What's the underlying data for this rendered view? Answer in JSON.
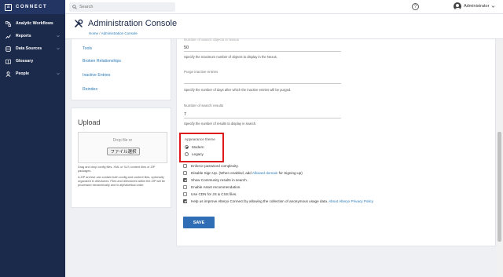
{
  "app": {
    "logo_letter": "a",
    "logo_text": "CONNECT"
  },
  "sidebar": {
    "items": [
      {
        "label": "Analytic Workflows",
        "icon": "workflow-icon",
        "has_chevron": false
      },
      {
        "label": "Reports",
        "icon": "chart-line-icon",
        "has_chevron": true
      },
      {
        "label": "Data Sources",
        "icon": "database-icon",
        "has_chevron": true
      },
      {
        "label": "Glossary",
        "icon": "book-icon",
        "has_chevron": false
      },
      {
        "label": "People",
        "icon": "person-icon",
        "has_chevron": true
      }
    ]
  },
  "topbar": {
    "search_placeholder": "Search",
    "help_label": "?",
    "user_name": "Administrator"
  },
  "header": {
    "title": "Administration Console",
    "breadcrumb_home": "Home",
    "breadcrumb_separator": "/",
    "breadcrumb_current": "Administration Console"
  },
  "left_nav": {
    "links": [
      "Tools",
      "Broken Relationships",
      "Inactive Entries",
      "Reindex"
    ]
  },
  "upload": {
    "title": "Upload",
    "drop_text": "Drop file or",
    "file_button": "ファイル選択",
    "note_1": "Drag and drop config files, XML or XLS content files or ZIP packages.",
    "note_2": "A ZIP archive can contain both config and content files, optionally organized in directories. Files and directories within the ZIP will be processed hierarchically and in alphabetical order."
  },
  "settings": {
    "field1_label": "Number of search objects in Nexus",
    "field1_value": "50",
    "field1_help": "Specify the maximum number of objects to display in the Nexus.",
    "field2_label": "Purge inactive entries",
    "field2_value": "",
    "field2_help": "Specify the number of days after which the inactive entries will be purged.",
    "field3_label": "Number of search results",
    "field3_value": "7",
    "field3_help": "Specify the number of results to display in search.",
    "appearance_title": "Appearance theme",
    "theme_modern": "Modern",
    "theme_legacy": "Legacy",
    "selected_theme": "Modern",
    "checkboxes": [
      {
        "label": "Enforce password complexity.",
        "checked": false
      },
      {
        "label": "Disable Sign Up. (When enabled, add ",
        "link": "Allowed domain",
        "suffix": " for Signing-up)",
        "checked": false
      },
      {
        "label": "Show Community results in search.",
        "checked": true
      },
      {
        "label": "Enable Asset recommendation.",
        "checked": false
      },
      {
        "label": "Use CDN for JS & CSS files.",
        "checked": false
      },
      {
        "label": "Help us improve Alteryx Connect by allowing the collection of anonymous usage data. ",
        "link": "About Alteryx Privacy Policy",
        "suffix": "",
        "checked": true
      }
    ],
    "save_label": "SAVE"
  },
  "colors": {
    "sidebar_bg": "#1b2a4a",
    "accent": "#2f6db4",
    "highlight_box": "#e01a1a",
    "link": "#2a7ab8"
  }
}
